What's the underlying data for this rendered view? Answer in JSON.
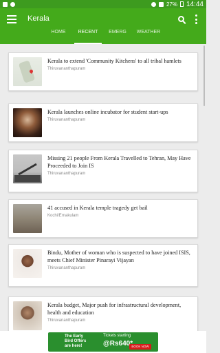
{
  "status_bar": {
    "battery": "27%",
    "time": "14:44"
  },
  "app_bar": {
    "title": "Kerala"
  },
  "tabs": [
    {
      "label": "HOME",
      "active": false
    },
    {
      "label": "RECENT",
      "active": true
    },
    {
      "label": "EMERG",
      "active": false
    },
    {
      "label": "WEATHER",
      "active": false
    }
  ],
  "articles": [
    {
      "headline": "Kerala to extend 'Community Kitchens' to all tribal hamlets",
      "location": "Thiruvananthapuram",
      "icon": "map-thumbnail"
    },
    {
      "headline": "Kerala launches online incubator for student start-ups",
      "location": "Thiruvananthapuram",
      "icon": "crowd-photo-thumbnail"
    },
    {
      "headline": "Missing 21 people  From Kerala Travelled to Tehran, May Have Proceeded to Join IS",
      "location": "Thiruvananthapuram",
      "icon": "aircraft-silhouette-thumbnail"
    },
    {
      "headline": "41 accused in Kerala temple tragedy get bail",
      "location": "Kochi/Ernakulam",
      "icon": "ruins-photo-thumbnail"
    },
    {
      "headline": "Bindu, Mother of woman who is suspected to have joined ISIS, meets Chief Minister Pinarayi Vijayan",
      "location": "Thiruvananthapuram",
      "icon": "portrait-photo-thumbnail"
    },
    {
      "headline": "Kerala budget,  Major push for infrastructural development, health and education",
      "location": "Thiruvananthapuram",
      "icon": "speaker-photo-thumbnail"
    }
  ],
  "ad": {
    "line1": "The Early",
    "line2": "Bird Offers",
    "line3": "are here!",
    "tickets": "Tickets starting",
    "price": "@Rs640*",
    "cta": "BOOK NOW"
  },
  "colors": {
    "app_bar": "#44aa1b",
    "status_bar": "#3d9b1f",
    "background": "#ececec",
    "ad_background": "#2a8f2e",
    "ad_cta": "#d61b1b"
  }
}
